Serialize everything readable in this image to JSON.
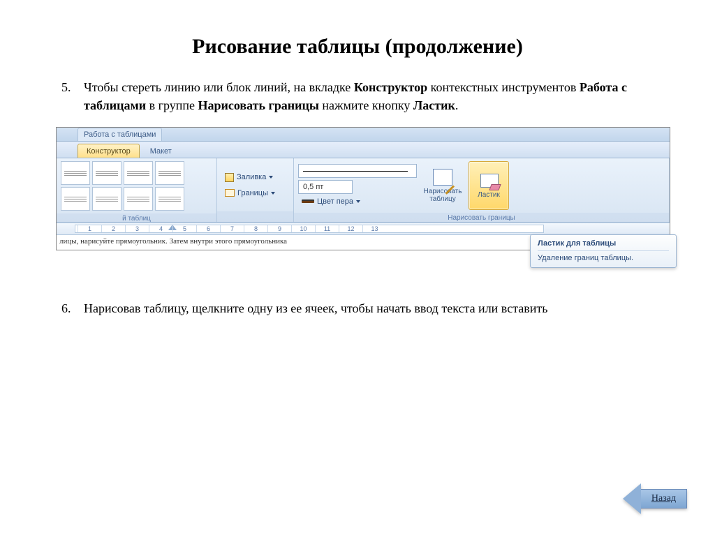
{
  "title": "Рисование таблицы (продолжение)",
  "item5": {
    "number": "5.",
    "t1": "Чтобы стереть линию или блок линий, на вкладке ",
    "b1": "Конструктор",
    "t2": " контекстных инструментов ",
    "b2": "Работа с таблицами",
    "t3": " в группе ",
    "b3": "Нарисовать границы",
    "t4": " нажмите кнопку ",
    "b4": "Ластик",
    "t5": "."
  },
  "item6": {
    "number": "6.",
    "text": "Нарисовав таблицу, щелкните одну из ее ячеек, чтобы начать ввод текста или вставить"
  },
  "ribbon": {
    "contextTitle": "Работа с таблицами",
    "tabs": {
      "design": "Конструктор",
      "layout": "Макет"
    },
    "styles_group_label": "й таблиц",
    "shading": "Заливка",
    "borders": "Границы",
    "weight": "0,5 пт",
    "penColor": "Цвет пера",
    "drawBorders_group": "Нарисовать границы",
    "drawTable": "Нарисовать таблицу",
    "eraser": "Ластик"
  },
  "ruler_numbers": [
    "1",
    "2",
    "3",
    "4",
    "5",
    "6",
    "7",
    "8",
    "9",
    "10",
    "11",
    "12",
    "13"
  ],
  "doc_snippet": "лицы, нарисуйте прямоугольник. Затем внутри этого прямоугольника",
  "tooltip": {
    "title": "Ластик для таблицы",
    "body": "Удаление границ таблицы."
  },
  "back": "Назад"
}
